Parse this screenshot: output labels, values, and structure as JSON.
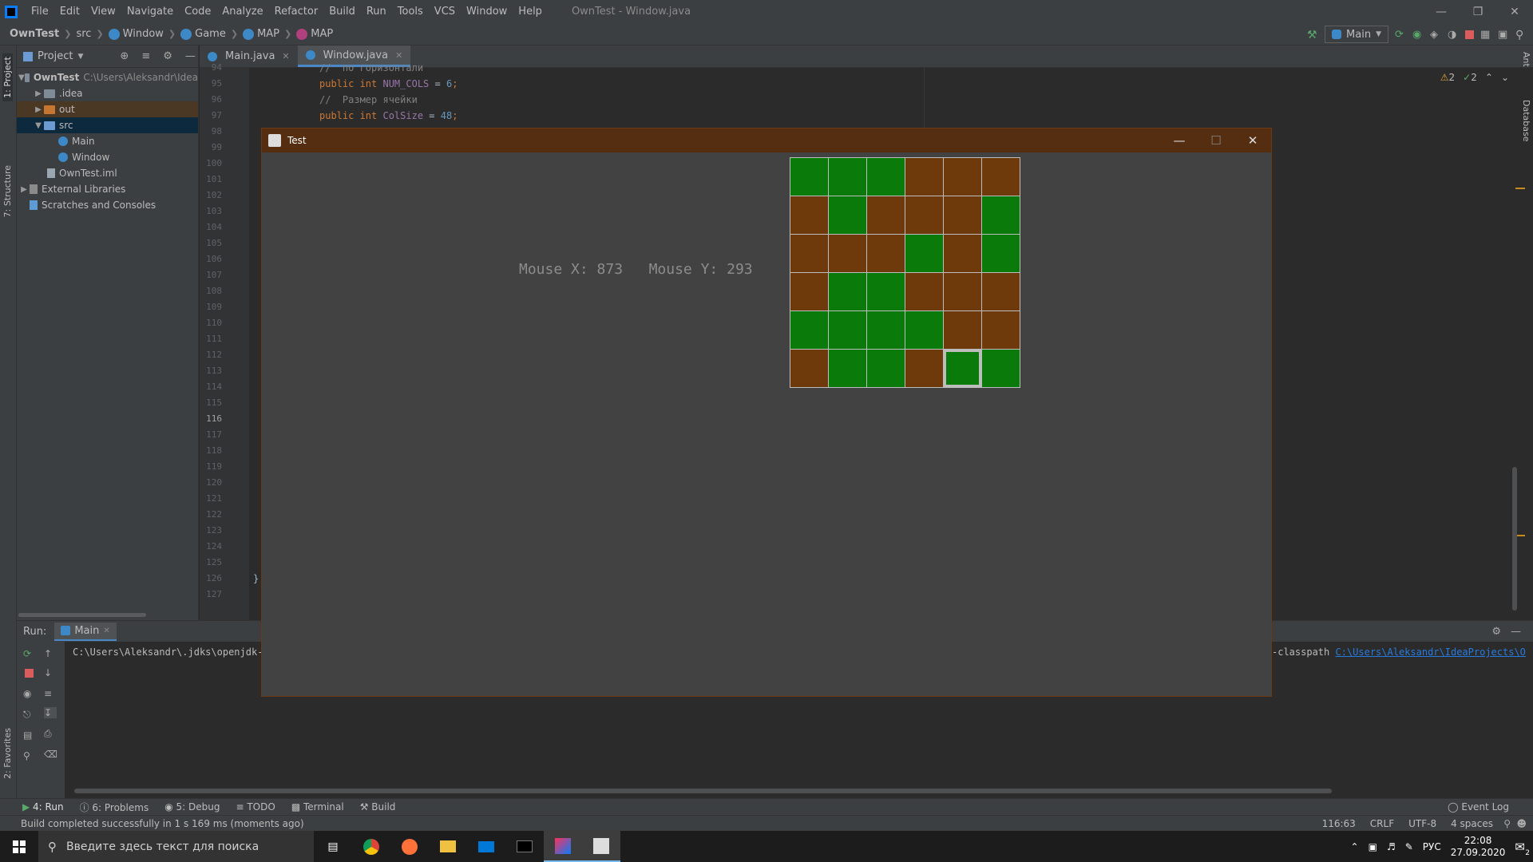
{
  "ide": {
    "menu": [
      "File",
      "Edit",
      "View",
      "Navigate",
      "Code",
      "Analyze",
      "Refactor",
      "Build",
      "Run",
      "Tools",
      "VCS",
      "Window",
      "Help"
    ],
    "title": "OwnTest - Window.java",
    "breadcrumbs": [
      "OwnTest",
      "src",
      "Window",
      "Game",
      "MAP",
      "MAP"
    ],
    "run_config": "Main",
    "project_panel": {
      "title": "Project",
      "tree": [
        {
          "label": "OwnTest",
          "extra": "C:\\Users\\Aleksandr\\Idea",
          "depth": 0,
          "kind": "project",
          "expanded": true
        },
        {
          "label": ".idea",
          "depth": 1,
          "kind": "folder",
          "expanded": false
        },
        {
          "label": "out",
          "depth": 1,
          "kind": "folder-orange",
          "expanded": false
        },
        {
          "label": "src",
          "depth": 1,
          "kind": "folder-blue",
          "expanded": true,
          "selected": true
        },
        {
          "label": "Main",
          "depth": 2,
          "kind": "class"
        },
        {
          "label": "Window",
          "depth": 2,
          "kind": "class"
        },
        {
          "label": "OwnTest.iml",
          "depth": 1,
          "kind": "file"
        },
        {
          "label": "External Libraries",
          "depth": 0,
          "kind": "lib",
          "expanded": false
        },
        {
          "label": "Scratches and Consoles",
          "depth": 0,
          "kind": "scratch"
        }
      ]
    },
    "editor_tabs": [
      {
        "label": "Main.java",
        "active": false
      },
      {
        "label": "Window.java",
        "active": true
      }
    ],
    "line_numbers": [
      "94",
      "95",
      "96",
      "97",
      "98",
      "99",
      "100",
      "101",
      "102",
      "103",
      "104",
      "105",
      "106",
      "107",
      "108",
      "109",
      "110",
      "111",
      "112",
      "113",
      "114",
      "115",
      "116",
      "117",
      "118",
      "119",
      "120",
      "121",
      "122",
      "123",
      "124",
      "125",
      "126",
      "127"
    ],
    "current_line": "116",
    "code": {
      "l94": "//  по горизонтали",
      "l95_kw": "public int ",
      "l95_fld": "NUM_COLS",
      "l95_rest": " = ",
      "l95_num": "6",
      "l95_end": ";",
      "l96": "//  Размер ячейки",
      "l97_kw": "public int ",
      "l97_fld": "ColSize",
      "l97_rest": " = ",
      "l97_num": "48",
      "l97_end": ";",
      "l126": "}"
    },
    "inspections": {
      "warnings": "2",
      "ok": "2"
    },
    "left_strip": [
      "1: Project",
      "7: Structure",
      "2: Favorites"
    ],
    "right_strip": [
      "Ant",
      "Database"
    ],
    "run_panel": {
      "label": "Run:",
      "tab": "Main",
      "console_path": "C:\\Users\\Aleksandr\\.jdks\\openjdk-1",
      "console_cp_prefix": "-classpath ",
      "console_cp_link": "C:\\Users\\Aleksandr\\IdeaProjects\\O"
    },
    "bottom_tabs": [
      "4: Run",
      "6: Problems",
      "5: Debug",
      "TODO",
      "Terminal",
      "Build"
    ],
    "event_log": "Event Log",
    "status": "Build completed successfully in 1 s 169 ms (moments ago)",
    "status_right": [
      "116:63",
      "CRLF",
      "UTF-8",
      "4 spaces"
    ]
  },
  "app_window": {
    "title": "Test",
    "mouse_x_label": "Mouse X: ",
    "mouse_x": "873",
    "mouse_y_label": "Mouse Y: ",
    "mouse_y": "293",
    "grid": [
      [
        "green",
        "green",
        "green",
        "brown",
        "brown",
        "brown"
      ],
      [
        "brown",
        "green",
        "brown",
        "brown",
        "brown",
        "green"
      ],
      [
        "brown",
        "brown",
        "brown",
        "green",
        "brown",
        "green"
      ],
      [
        "brown",
        "green",
        "green",
        "brown",
        "brown",
        "brown"
      ],
      [
        "green",
        "green",
        "green",
        "green",
        "brown",
        "brown"
      ],
      [
        "brown",
        "green",
        "green",
        "brown",
        "green",
        "green"
      ]
    ],
    "highlight": {
      "row": 5,
      "col": 4
    },
    "colors": {
      "green": "#0a7a0a",
      "brown": "#6e3a0c",
      "titlebar": "#552e11"
    }
  },
  "taskbar": {
    "search_placeholder": "Введите здесь текст для поиска",
    "lang": "РУС",
    "time": "22:08",
    "date": "27.09.2020",
    "notifications": "2"
  }
}
